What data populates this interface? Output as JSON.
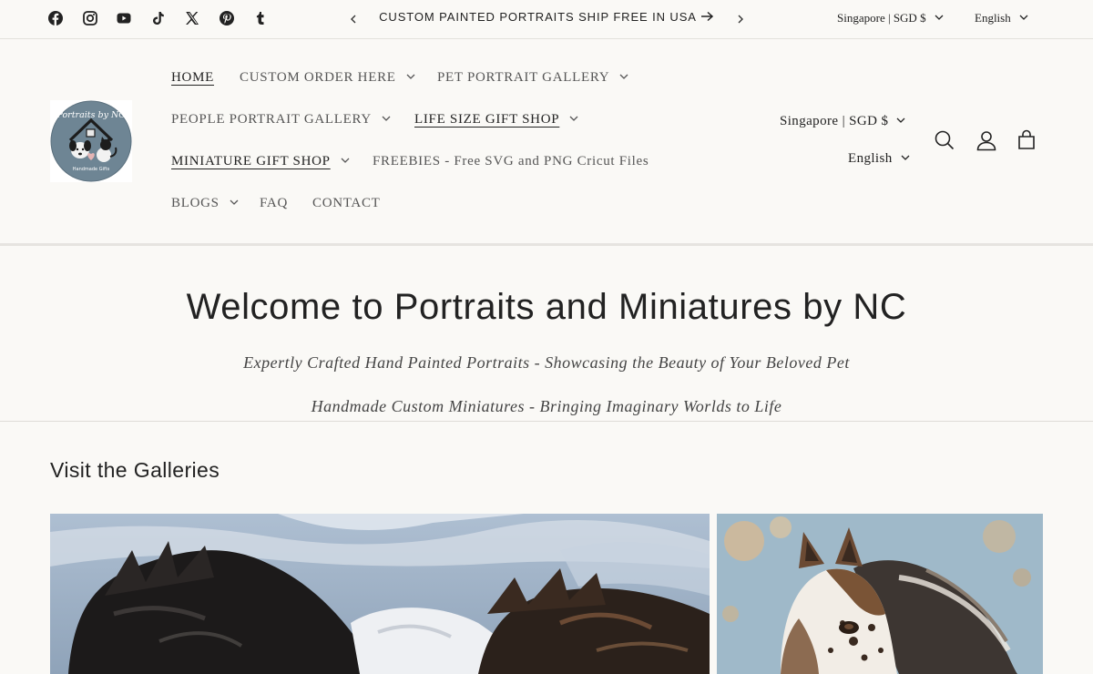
{
  "announcement": {
    "social_icons": [
      "facebook-icon",
      "instagram-icon",
      "youtube-icon",
      "tiktok-icon",
      "x-icon",
      "pinterest-icon",
      "tumblr-icon"
    ],
    "message": "CUSTOM PAINTED PORTRAITS SHIP FREE IN USA",
    "country": "Singapore | SGD $",
    "language": "English"
  },
  "header": {
    "logo_text": "Portraits by NC",
    "logo_subtext": "Handmade Gifts",
    "nav": [
      {
        "label": "HOME",
        "has_dropdown": false,
        "underlined": true
      },
      {
        "label": "CUSTOM ORDER HERE",
        "has_dropdown": true,
        "underlined": false
      },
      {
        "label": "PET PORTRAIT GALLERY",
        "has_dropdown": true,
        "underlined": false
      },
      {
        "label": "PEOPLE PORTRAIT GALLERY",
        "has_dropdown": true,
        "underlined": false
      },
      {
        "label": "LIFE SIZE GIFT SHOP",
        "has_dropdown": true,
        "underlined": true
      },
      {
        "label": "MINIATURE GIFT SHOP",
        "has_dropdown": true,
        "underlined": true
      },
      {
        "label": "FREEBIES - Free SVG and PNG Cricut Files",
        "has_dropdown": false,
        "underlined": false
      },
      {
        "label": "BLOGS",
        "has_dropdown": true,
        "underlined": false
      },
      {
        "label": "FAQ",
        "has_dropdown": false,
        "underlined": false
      },
      {
        "label": "CONTACT",
        "has_dropdown": false,
        "underlined": false
      }
    ],
    "country": "Singapore | SGD $",
    "language": "English",
    "icons": [
      "search-icon",
      "account-icon",
      "cart-icon"
    ]
  },
  "hero": {
    "title": "Welcome to Portraits and Miniatures by NC",
    "subtitle_1": "Expertly Crafted Hand Painted Portraits - Showcasing the Beauty of Your Beloved Pet",
    "subtitle_2": "Handmade Custom Miniatures - Bringing Imaginary Worlds to Life"
  },
  "galleries": {
    "title": "Visit the Galleries",
    "cards": [
      {
        "image": "painted-dog-portrait"
      },
      {
        "image": "painted-horse-portrait"
      }
    ]
  },
  "colors": {
    "background": "#faf9f6",
    "text": "#222222",
    "muted_text": "#555555",
    "logo_circle": "#6e8594"
  }
}
